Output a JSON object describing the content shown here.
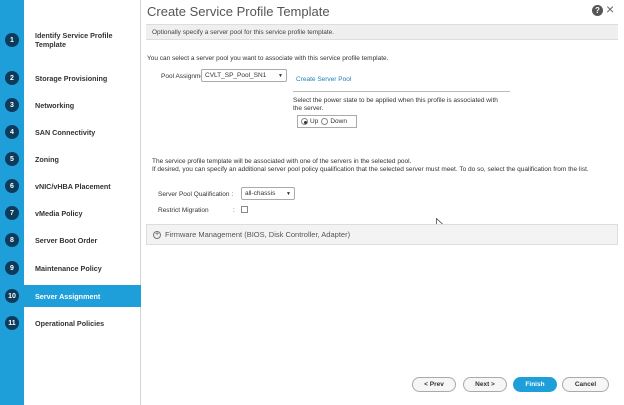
{
  "wizard": {
    "steps": [
      {
        "num": "1",
        "label": "Identify Service Profile Template"
      },
      {
        "num": "2",
        "label": "Storage Provisioning"
      },
      {
        "num": "3",
        "label": "Networking"
      },
      {
        "num": "4",
        "label": "SAN Connectivity"
      },
      {
        "num": "5",
        "label": "Zoning"
      },
      {
        "num": "6",
        "label": "vNIC/vHBA Placement"
      },
      {
        "num": "7",
        "label": "vMedia Policy"
      },
      {
        "num": "8",
        "label": "Server Boot Order"
      },
      {
        "num": "9",
        "label": "Maintenance Policy"
      },
      {
        "num": "10",
        "label": "Server Assignment"
      },
      {
        "num": "11",
        "label": "Operational Policies"
      }
    ],
    "active_step": "10"
  },
  "header": {
    "title": "Create Service Profile Template",
    "help": "?",
    "close": "×"
  },
  "main": {
    "info": "Optionally specify a server pool for this service profile template.",
    "pool_intro": "You can select a server pool you want to associate with this service profile template.",
    "pool_label": "Pool Assignment:",
    "pool_value": "CVLT_SP_Pool_SN1",
    "create_pool_link": "Create Server Pool",
    "power_text": "Select the power state to be applied when this profile is associated with the server.",
    "power_up": "Up",
    "power_down": "Down",
    "power_selected": "Up",
    "assoc_text": "The service profile template will be associated with one of the servers in the selected pool.",
    "qual_text": "If desired, you can specify an additional server pool policy qualification that the selected server must meet. To do so, select the qualification from the list.",
    "qual_label": "Server Pool Qualification :",
    "qual_value": "all-chassis",
    "restrict_label": "Restrict Migration",
    "restrict_colon": ":",
    "restrict_checked": false,
    "firmware_label": "Firmware Management (BIOS, Disk Controller, Adapter)"
  },
  "footer": {
    "prev": "< Prev",
    "next": "Next >",
    "finish": "Finish",
    "cancel": "Cancel"
  },
  "colors": {
    "accent": "#1f9fd9",
    "step_badge": "#0d3b5c"
  }
}
